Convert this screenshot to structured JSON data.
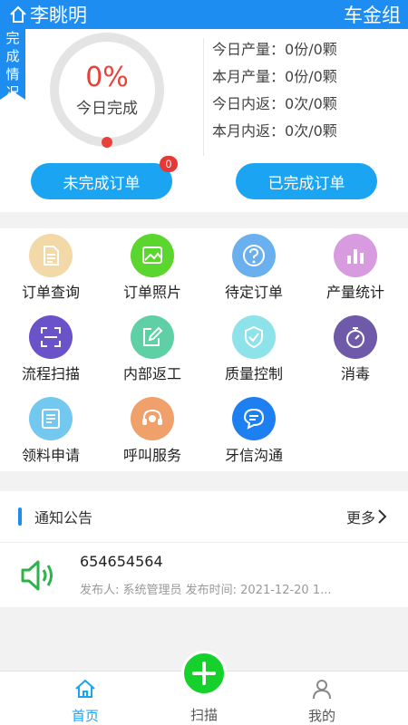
{
  "header": {
    "user_name": "李眺明",
    "group": "车金组"
  },
  "stats": {
    "ribbon": [
      "完",
      "成",
      "情",
      "况"
    ],
    "progress_percent": 0,
    "percent_text": "0%",
    "percent_label": "今日完成",
    "rows": [
      {
        "label": "今日产量：",
        "value": "0份/0颗"
      },
      {
        "label": "本月产量：",
        "value": "0份/0颗"
      },
      {
        "label": "今日内返：",
        "value": "0次/0颗"
      },
      {
        "label": "本月内返：",
        "value": "0次/0颗"
      }
    ],
    "undone_button": "未完成订单",
    "undone_badge": "0",
    "done_button": "已完成订单"
  },
  "menu": [
    {
      "label": "订单查询",
      "color": "#f3d9a8",
      "icon": "document-icon"
    },
    {
      "label": "订单照片",
      "color": "#5bd62e",
      "icon": "photo-icon"
    },
    {
      "label": "待定订单",
      "color": "#6bb0ee",
      "icon": "question-icon"
    },
    {
      "label": "产量统计",
      "color": "#d99be0",
      "icon": "bar-chart-icon"
    },
    {
      "label": "流程扫描",
      "color": "#6a52c8",
      "icon": "scan-icon"
    },
    {
      "label": "内部返工",
      "color": "#5fd0a6",
      "icon": "edit-icon"
    },
    {
      "label": "质量控制",
      "color": "#8ee3ea",
      "icon": "shield-check-icon"
    },
    {
      "label": "消毒",
      "color": "#6e5aa8",
      "icon": "timer-icon"
    },
    {
      "label": "领料申请",
      "color": "#73c8f0",
      "icon": "form-icon"
    },
    {
      "label": "呼叫服务",
      "color": "#f0a06a",
      "icon": "headset-icon"
    },
    {
      "label": "牙信沟通",
      "color": "#1d7ff0",
      "icon": "chat-icon"
    }
  ],
  "notice": {
    "title": "通知公告",
    "more": "更多",
    "item": {
      "title": "654654564",
      "meta": "发布人: 系统管理员   发布时间: 2021-12-20 1..."
    }
  },
  "tabbar": {
    "home": "首页",
    "scan": "扫描",
    "mine": "我的"
  },
  "colors": {
    "primary": "#1d8df2",
    "accent": "#1aa4f2",
    "scan": "#16d02c",
    "danger": "#e53935"
  }
}
